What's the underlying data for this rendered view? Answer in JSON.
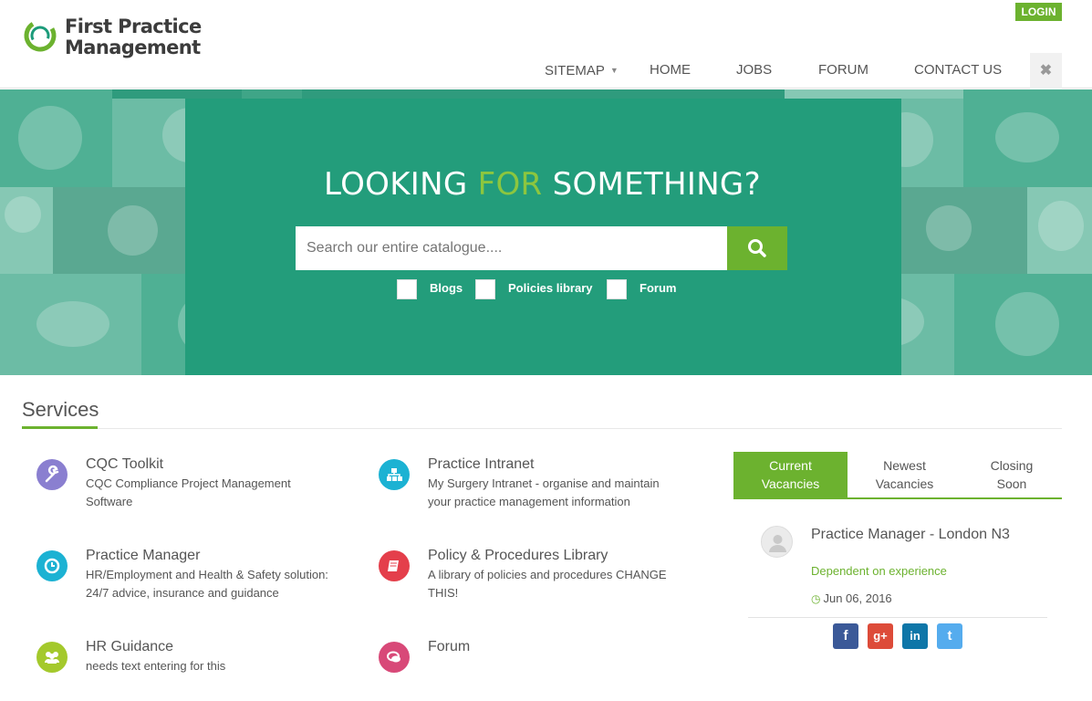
{
  "header": {
    "logo_line1": "First Practice",
    "logo_line2": "Management",
    "login_label": "LOGIN",
    "nav": [
      {
        "label": "SITEMAP",
        "has_dropdown": true
      },
      {
        "label": "HOME"
      },
      {
        "label": "JOBS"
      },
      {
        "label": "FORUM"
      },
      {
        "label": "CONTACT US"
      }
    ],
    "close_glyph": "✖"
  },
  "hero": {
    "title_part1": "LOOKING ",
    "title_highlight": "FOR",
    "title_part2": " SOMETHING?",
    "search_placeholder": "Search our entire catalogue....",
    "filters": [
      "Blogs",
      "Policies library",
      "Forum"
    ]
  },
  "services": {
    "heading": "Services",
    "items": [
      {
        "title": "CQC Toolkit",
        "desc_line1": "CQC Compliance Project Management",
        "desc_line2": "Software",
        "icon": "wrench-icon",
        "color": "#8a7fd0"
      },
      {
        "title": "Practice Intranet",
        "desc_line1": "My Surgery Intranet - organise and maintain",
        "desc_line2": "your practice management information",
        "icon": "sitemap-icon",
        "color": "#1cb2d3"
      },
      {
        "title": "Practice Manager",
        "desc_line1": "HR/Employment and Health & Safety solution:",
        "desc_line2": "24/7 advice, insurance and guidance",
        "icon": "clock-icon",
        "color": "#1cb2d3"
      },
      {
        "title": "Policy & Procedures Library",
        "desc_line1": "A library of policies and procedures CHANGE",
        "desc_line2": "THIS!",
        "icon": "book-icon",
        "color": "#e43f4b"
      },
      {
        "title": "HR Guidance",
        "desc_line1": "needs text entering for this",
        "desc_line2": "",
        "icon": "users-icon",
        "color": "#a4c92c"
      },
      {
        "title": "Forum",
        "desc_line1": "",
        "desc_line2": "",
        "icon": "comments-icon",
        "color": "#d84978"
      }
    ]
  },
  "vacancies": {
    "tabs": [
      {
        "line1": "Current",
        "line2": "Vacancies",
        "active": true
      },
      {
        "line1": "Newest",
        "line2": "Vacancies",
        "active": false
      },
      {
        "line1": "Closing",
        "line2": "Soon",
        "active": false
      }
    ],
    "items": [
      {
        "title": "Practice Manager - London N3",
        "salary": "Dependent on experience",
        "date": "Jun 06, 2016"
      }
    ]
  },
  "social": [
    {
      "name": "facebook-icon",
      "glyph": "f",
      "color": "#3b5998"
    },
    {
      "name": "google-plus-icon",
      "glyph": "g+",
      "color": "#dd4b39"
    },
    {
      "name": "linkedin-icon",
      "glyph": "in",
      "color": "#0e76a8"
    },
    {
      "name": "twitter-icon",
      "glyph": "t",
      "color": "#55acee"
    }
  ],
  "colors": {
    "accent_green": "#6cb22f",
    "hero_teal": "#239d7b",
    "highlight_green": "#8cc63f"
  }
}
